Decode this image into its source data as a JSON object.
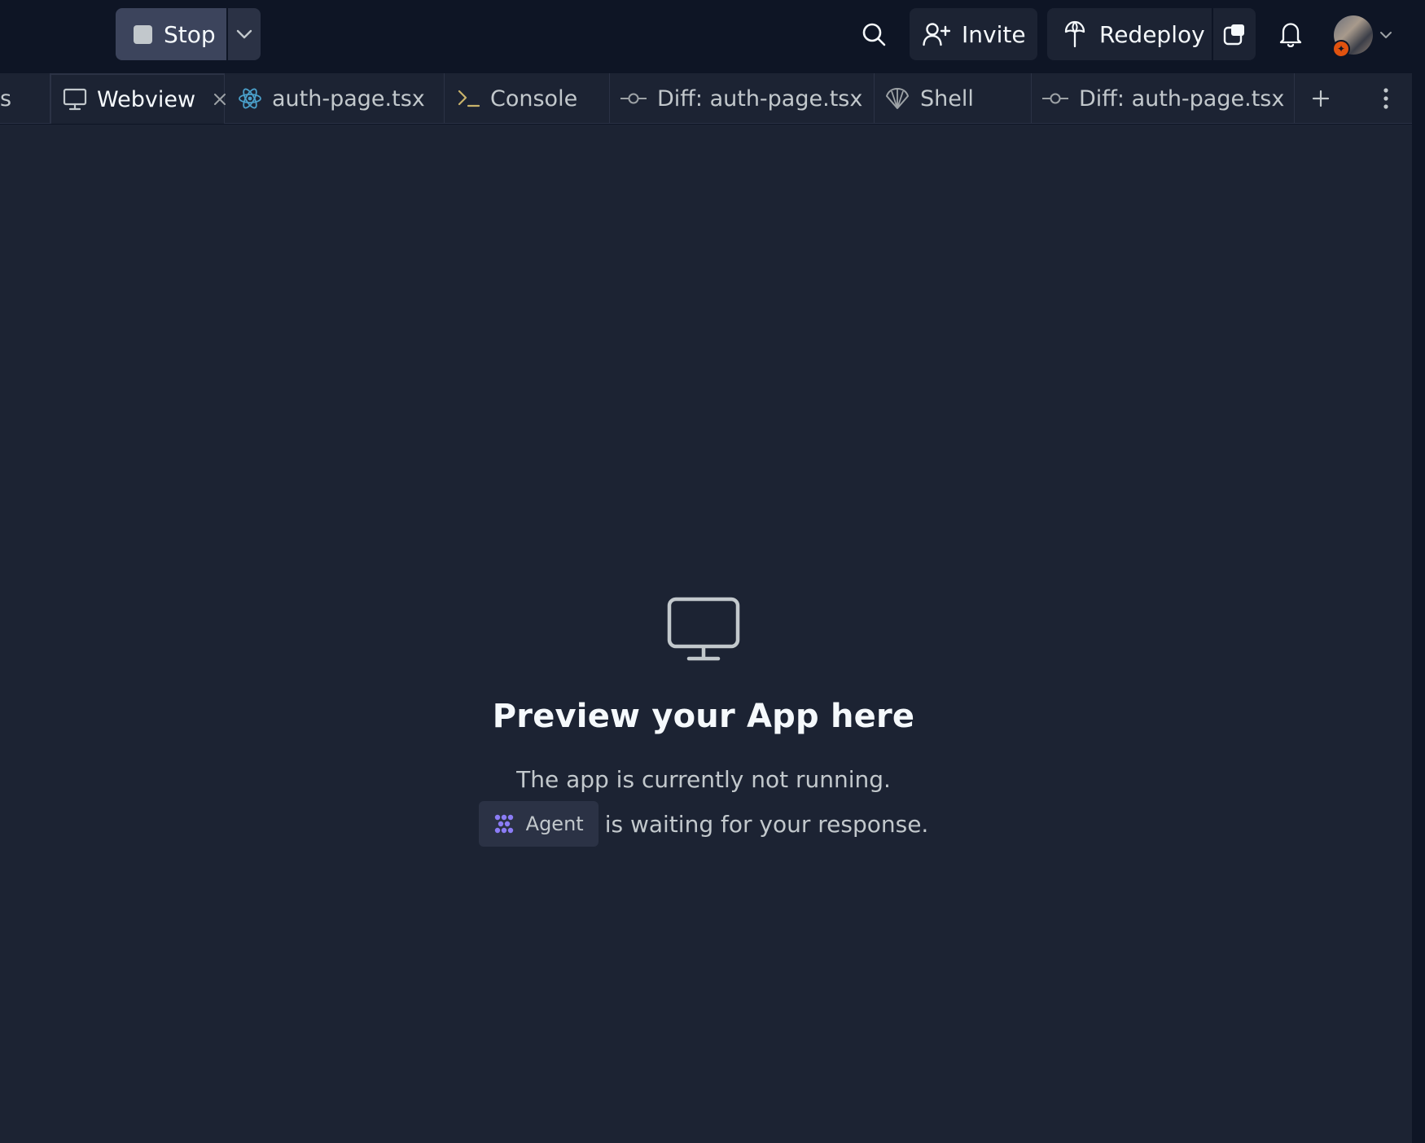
{
  "topbar": {
    "stop_label": "Stop",
    "invite_label": "Invite",
    "redeploy_label": "Redeploy"
  },
  "tabs": [
    {
      "label": "s",
      "icon": "none"
    },
    {
      "label": "Webview",
      "icon": "monitor-icon",
      "active": true
    },
    {
      "label": "auth-page.tsx",
      "icon": "react-icon"
    },
    {
      "label": "Console",
      "icon": "terminal-icon"
    },
    {
      "label": "Diff: auth-page.tsx",
      "icon": "git-commit-icon"
    },
    {
      "label": "Shell",
      "icon": "shell-icon"
    },
    {
      "label": "Diff: auth-page.tsx",
      "icon": "git-commit-icon"
    }
  ],
  "empty_state": {
    "title": "Preview your App here",
    "line1": "The app is currently not running.",
    "agent_label": "Agent",
    "line2_suffix": "is waiting for your response."
  },
  "colors": {
    "background": "#0e1525",
    "panel": "#1c2333",
    "border": "#2b3245",
    "agent_accent": "#8b7cf6",
    "react_blue": "#4a9fc9",
    "avatar_badge": "#e0520f"
  }
}
